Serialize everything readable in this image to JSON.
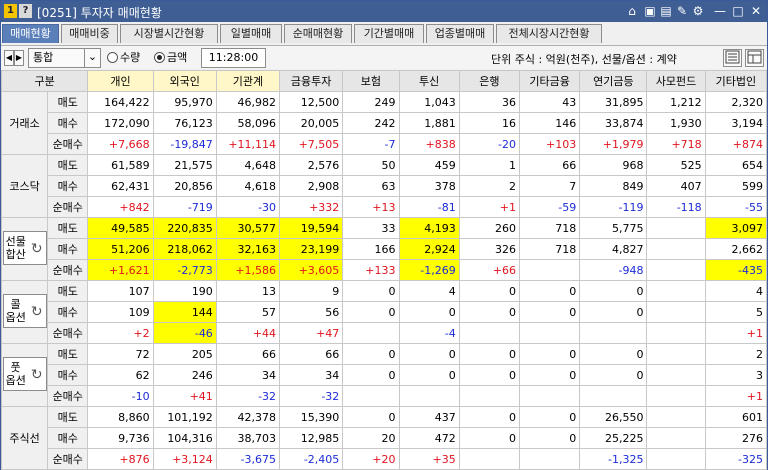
{
  "window": {
    "screen_number": "1",
    "help": "?",
    "title": "[0251] 투자자 매매현황",
    "controls": [
      "⌂",
      "▣",
      "▤",
      "✎",
      "⚙",
      "—",
      "□",
      "✕"
    ]
  },
  "tabs": [
    "매매현황",
    "매매비중",
    "시장별시간현황",
    "일별매매",
    "순매매현황",
    "기간별매매",
    "업종별매매",
    "전체시장시간현황"
  ],
  "toolbar": {
    "prev": "◀",
    "next": "▶",
    "market_select": "통합",
    "chevron": "⌄",
    "radio_quantity": "수량",
    "radio_amount": "금액",
    "selected": "amount",
    "time": "11:28:00",
    "unit_text": "단위 주식 : 억원(천주), 선물/옵션 : 계약"
  },
  "table": {
    "corner": "구분",
    "columns": [
      "개인",
      "외국인",
      "기관계",
      "금융투자",
      "보험",
      "투신",
      "은행",
      "기타금융",
      "연기금등",
      "사모펀드",
      "기타법인"
    ],
    "groups": [
      {
        "label": "거래소",
        "lines": [
          "거래소"
        ],
        "button": false,
        "rows": [
          {
            "type": "매도",
            "vals": [
              "164,422",
              "95,970",
              "46,982",
              "12,500",
              "249",
              "1,043",
              "36",
              "43",
              "31,895",
              "1,212",
              "2,320"
            ],
            "cls": [
              "",
              "",
              "",
              "",
              "",
              "",
              "",
              "",
              "",
              "",
              ""
            ]
          },
          {
            "type": "매수",
            "vals": [
              "172,090",
              "76,123",
              "58,096",
              "20,005",
              "242",
              "1,881",
              "16",
              "146",
              "33,874",
              "1,930",
              "3,194"
            ],
            "cls": [
              "",
              "",
              "",
              "",
              "",
              "",
              "",
              "",
              "",
              "",
              ""
            ]
          },
          {
            "type": "순매수",
            "vals": [
              "+7,668",
              "-19,847",
              "+11,114",
              "+7,505",
              "-7",
              "+838",
              "-20",
              "+103",
              "+1,979",
              "+718",
              "+874"
            ],
            "cls": [
              "r",
              "b",
              "r",
              "r",
              "b",
              "r",
              "b",
              "r",
              "r",
              "r",
              "r"
            ]
          }
        ]
      },
      {
        "label": "코스닥",
        "lines": [
          "코스닥"
        ],
        "button": false,
        "rows": [
          {
            "type": "매도",
            "vals": [
              "61,589",
              "21,575",
              "4,648",
              "2,576",
              "50",
              "459",
              "1",
              "66",
              "968",
              "525",
              "654"
            ],
            "cls": [
              "",
              "",
              "",
              "",
              "",
              "",
              "",
              "",
              "",
              "",
              ""
            ]
          },
          {
            "type": "매수",
            "vals": [
              "62,431",
              "20,856",
              "4,618",
              "2,908",
              "63",
              "378",
              "2",
              "7",
              "849",
              "407",
              "599"
            ],
            "cls": [
              "",
              "",
              "",
              "",
              "",
              "",
              "",
              "",
              "",
              "",
              ""
            ]
          },
          {
            "type": "순매수",
            "vals": [
              "+842",
              "-719",
              "-30",
              "+332",
              "+13",
              "-81",
              "+1",
              "-59",
              "-119",
              "-118",
              "-55"
            ],
            "cls": [
              "r",
              "b",
              "b",
              "r",
              "r",
              "b",
              "r",
              "b",
              "b",
              "b",
              "b"
            ]
          }
        ]
      },
      {
        "label": "선물합산",
        "lines": [
          "선물",
          "합산"
        ],
        "button": true,
        "rows": [
          {
            "type": "매도",
            "vals": [
              "49,585",
              "220,835",
              "30,577",
              "19,594",
              "33",
              "4,193",
              "260",
              "718",
              "5,775",
              "",
              "3,097"
            ],
            "cls": [
              "y",
              "y",
              "y",
              "y",
              "",
              "y",
              "",
              "",
              "",
              "",
              "y"
            ]
          },
          {
            "type": "매수",
            "vals": [
              "51,206",
              "218,062",
              "32,163",
              "23,199",
              "166",
              "2,924",
              "326",
              "718",
              "4,827",
              "",
              "2,662"
            ],
            "cls": [
              "y",
              "y",
              "y",
              "y",
              "",
              "y",
              "",
              "",
              "",
              "",
              ""
            ]
          },
          {
            "type": "순매수",
            "vals": [
              "+1,621",
              "-2,773",
              "+1,586",
              "+3,605",
              "+133",
              "-1,269",
              "+66",
              "",
              "-948",
              "",
              "-435"
            ],
            "cls": [
              "yr",
              "yb",
              "yr",
              "yr",
              "r",
              "yb",
              "r",
              "",
              "b",
              "",
              "yb"
            ]
          }
        ]
      },
      {
        "label": "콜옵션",
        "lines": [
          "콜",
          "옵션"
        ],
        "button": true,
        "rows": [
          {
            "type": "매도",
            "vals": [
              "107",
              "190",
              "13",
              "9",
              "0",
              "4",
              "0",
              "0",
              "0",
              "",
              "4"
            ],
            "cls": [
              "",
              "",
              "",
              "",
              "",
              "",
              "",
              "",
              "",
              "",
              ""
            ]
          },
          {
            "type": "매수",
            "vals": [
              "109",
              "144",
              "57",
              "56",
              "0",
              "0",
              "0",
              "0",
              "0",
              "",
              "5"
            ],
            "cls": [
              "",
              "y",
              "",
              "",
              "",
              "",
              "",
              "",
              "",
              "",
              ""
            ]
          },
          {
            "type": "순매수",
            "vals": [
              "+2",
              "-46",
              "+44",
              "+47",
              "",
              "-4",
              "",
              "",
              "",
              "",
              "+1"
            ],
            "cls": [
              "r",
              "yb",
              "r",
              "r",
              "",
              "b",
              "",
              "",
              "",
              "",
              "r"
            ]
          }
        ]
      },
      {
        "label": "풋옵션",
        "lines": [
          "풋",
          "옵션"
        ],
        "button": true,
        "rows": [
          {
            "type": "매도",
            "vals": [
              "72",
              "205",
              "66",
              "66",
              "0",
              "0",
              "0",
              "0",
              "0",
              "",
              "2"
            ],
            "cls": [
              "",
              "",
              "",
              "",
              "",
              "",
              "",
              "",
              "",
              "",
              ""
            ]
          },
          {
            "type": "매수",
            "vals": [
              "62",
              "246",
              "34",
              "34",
              "0",
              "0",
              "0",
              "0",
              "0",
              "",
              "3"
            ],
            "cls": [
              "",
              "",
              "",
              "",
              "",
              "",
              "",
              "",
              "",
              "",
              ""
            ]
          },
          {
            "type": "순매수",
            "vals": [
              "-10",
              "+41",
              "-32",
              "-32",
              "",
              "",
              "",
              "",
              "",
              "",
              "+1"
            ],
            "cls": [
              "b",
              "r",
              "b",
              "b",
              "",
              "",
              "",
              "",
              "",
              "",
              "r"
            ]
          }
        ]
      },
      {
        "label": "주식선",
        "lines": [
          "주식선"
        ],
        "button": false,
        "rows": [
          {
            "type": "매도",
            "vals": [
              "8,860",
              "101,192",
              "42,378",
              "15,390",
              "0",
              "437",
              "0",
              "0",
              "26,550",
              "",
              "601"
            ],
            "cls": [
              "",
              "",
              "",
              "",
              "",
              "",
              "",
              "",
              "",
              "",
              ""
            ]
          },
          {
            "type": "매수",
            "vals": [
              "9,736",
              "104,316",
              "38,703",
              "12,985",
              "20",
              "472",
              "0",
              "0",
              "25,225",
              "",
              "276"
            ],
            "cls": [
              "",
              "",
              "",
              "",
              "",
              "",
              "",
              "",
              "",
              "",
              ""
            ]
          },
          {
            "type": "순매수",
            "vals": [
              "+876",
              "+3,124",
              "-3,675",
              "-2,405",
              "+20",
              "+35",
              "",
              "",
              "-1,325",
              "",
              "-325"
            ],
            "cls": [
              "r",
              "r",
              "b",
              "b",
              "r",
              "r",
              "",
              "",
              "b",
              "",
              "b"
            ]
          }
        ]
      }
    ]
  }
}
